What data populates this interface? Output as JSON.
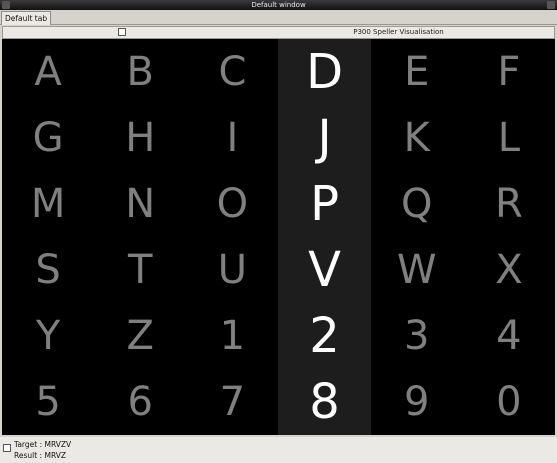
{
  "window": {
    "title": "Default window"
  },
  "tabs": [
    {
      "label": "Default tab"
    }
  ],
  "panel": {
    "title": "P300 Speller Visualisation"
  },
  "grid": {
    "rows": [
      [
        "A",
        "B",
        "C",
        "D",
        "E",
        "F"
      ],
      [
        "G",
        "H",
        "I",
        "J",
        "K",
        "L"
      ],
      [
        "M",
        "N",
        "O",
        "P",
        "Q",
        "R"
      ],
      [
        "S",
        "T",
        "U",
        "V",
        "W",
        "X"
      ],
      [
        "Y",
        "Z",
        "1",
        "2",
        "3",
        "4"
      ],
      [
        "5",
        "6",
        "7",
        "8",
        "9",
        "0"
      ]
    ],
    "highlighted_column": 3
  },
  "status": {
    "target_line": "Target : MRVZV",
    "result_line": "Result : MRVZ"
  },
  "colors": {
    "background": "#000000",
    "letter": "#808080",
    "flash_letter": "#ffffff",
    "flash_column": "#1d1d1d"
  }
}
